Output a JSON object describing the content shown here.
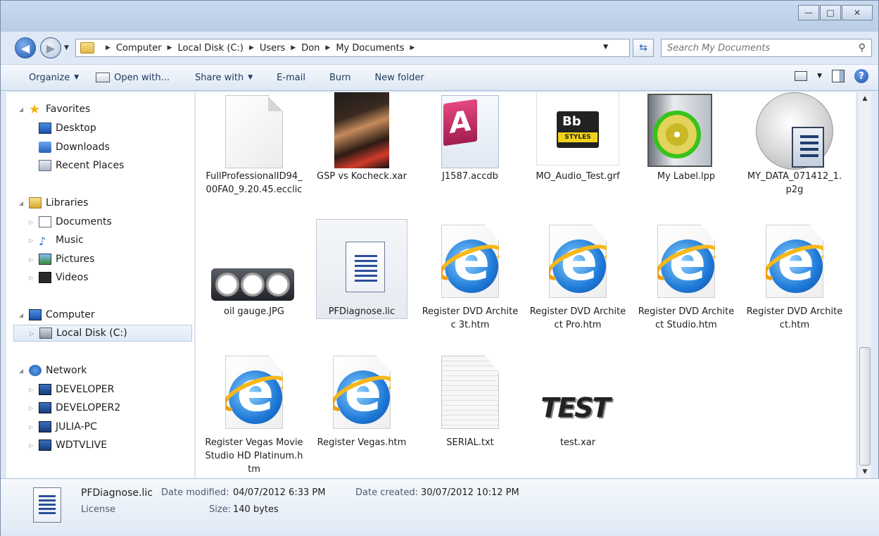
{
  "window": {
    "controls": {
      "minimize": "—",
      "maximize": "□",
      "close": "✕"
    }
  },
  "address": {
    "breadcrumb": [
      "Computer",
      "Local Disk (C:)",
      "Users",
      "Don",
      "My Documents"
    ],
    "search_placeholder": "Search My Documents"
  },
  "toolbar": {
    "organize": "Organize",
    "open_with": "Open with...",
    "share_with": "Share with",
    "email": "E-mail",
    "burn": "Burn",
    "new_folder": "New folder"
  },
  "nav": {
    "favorites": "Favorites",
    "desktop": "Desktop",
    "downloads": "Downloads",
    "recent_places": "Recent Places",
    "libraries": "Libraries",
    "documents": "Documents",
    "music": "Music",
    "pictures": "Pictures",
    "videos": "Videos",
    "computer": "Computer",
    "local_disk": "Local Disk (C:)",
    "network": "Network",
    "developer": "DEVELOPER",
    "developer2": "DEVELOPER2",
    "julia_pc": "JULIA-PC",
    "wdtvlive": "WDTVLIVE"
  },
  "files": [
    {
      "name": "FullProfessionalID94_00FA0_9.20.45.ecclic",
      "icon": "blank-document-icon"
    },
    {
      "name": "GSP vs Kocheck.xar",
      "icon": "photo-thumbnail-icon"
    },
    {
      "name": "J1587.accdb",
      "icon": "access-database-icon"
    },
    {
      "name": "MO_Audio_Test.grf",
      "icon": "bb-styles-icon"
    },
    {
      "name": "My Label.lpp",
      "icon": "label-disc-icon"
    },
    {
      "name": "MY_DATA_071412_1.p2g",
      "icon": "p2g-data-icon"
    },
    {
      "name": "oil gauge.JPG",
      "icon": "gauge-image-icon"
    },
    {
      "name": "PFDiagnose.lic",
      "icon": "license-document-icon"
    },
    {
      "name": "Register DVD Architec 3t.htm",
      "icon": "internet-explorer-icon"
    },
    {
      "name": "Register DVD Architect Pro.htm",
      "icon": "internet-explorer-icon"
    },
    {
      "name": "Register DVD Architect Studio.htm",
      "icon": "internet-explorer-icon"
    },
    {
      "name": "Register DVD Architect.htm",
      "icon": "internet-explorer-icon"
    },
    {
      "name": "Register Vegas Movie Studio HD Platinum.htm",
      "icon": "internet-explorer-icon"
    },
    {
      "name": "Register Vegas.htm",
      "icon": "internet-explorer-icon"
    },
    {
      "name": "SERIAL.txt",
      "icon": "text-document-icon"
    },
    {
      "name": "test.xar",
      "icon": "test-logo-icon"
    }
  ],
  "test_logo_text": "TEST",
  "bb_logo": {
    "line1": "Bb",
    "line2": "STYLES"
  },
  "access_logo": "A",
  "details": {
    "filename": "PFDiagnose.lic",
    "type": "License",
    "date_modified_label": "Date modified:",
    "date_modified": "04/07/2012 6:33 PM",
    "size_label": "Size:",
    "size": "140 bytes",
    "date_created_label": "Date created:",
    "date_created": "30/07/2012 10:12 PM"
  },
  "colors": {
    "accent": "#1e395b",
    "selection": "#dde9f7",
    "chrome": "#dfe9f5"
  }
}
